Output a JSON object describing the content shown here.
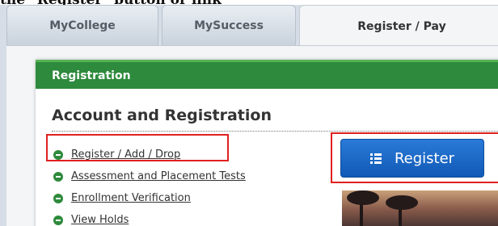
{
  "caption": "the \"Register\" button or link",
  "tabs": [
    {
      "label": "MyCollege"
    },
    {
      "label": "MySuccess"
    },
    {
      "label": "Register / Pay"
    }
  ],
  "card": {
    "header": "Registration",
    "section_title": "Account and Registration",
    "links": [
      {
        "label": "Register / Add / Drop"
      },
      {
        "label": "Assessment and Placement Tests"
      },
      {
        "label": "Enrollment Verification"
      },
      {
        "label": "View Holds"
      }
    ],
    "register_button": {
      "label": "Register",
      "icon": "list-icon"
    }
  },
  "colors": {
    "header_green": "#2e8a3c",
    "button_blue": "#1b6ac9",
    "highlight_red": "#e0201f"
  }
}
